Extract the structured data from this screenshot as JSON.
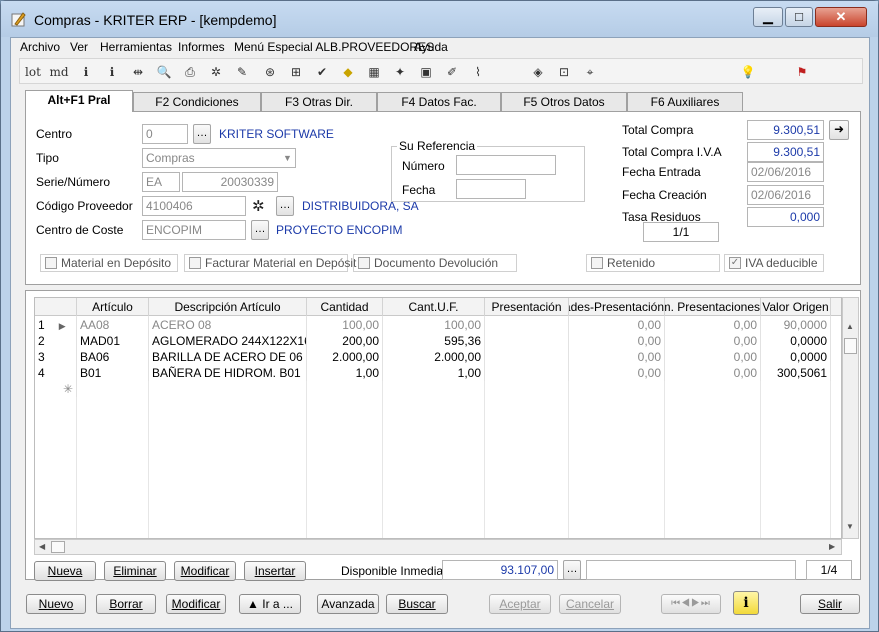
{
  "window": {
    "title": "Compras - KRITER ERP - [kempdemo]"
  },
  "menu": [
    "Archivo",
    "Ver",
    "Herramientas",
    "Informes",
    "Menú Especial ALB.PROVEEDORES",
    "Ayuda"
  ],
  "toolbar": {
    "lot_label": "lot",
    "md_label": "md"
  },
  "tabs": [
    "Alt+F1 Pral",
    "F2 Condiciones",
    "F3 Otras Dir.",
    "F4 Datos Fac.",
    "F5 Otros Datos",
    "F6 Auxiliares"
  ],
  "form": {
    "centro_label": "Centro",
    "centro_value": "0",
    "centro_name": "KRITER SOFTWARE",
    "tipo_label": "Tipo",
    "tipo_value": "Compras",
    "serie_label": "Serie/Número",
    "serie_value": "EA",
    "numero_value": "20030339",
    "proveedor_label": "Código Proveedor",
    "proveedor_value": "4100406",
    "proveedor_name": "DISTRIBUIDORA, SA",
    "coste_label": "Centro de Coste",
    "coste_value": "ENCOPIM",
    "coste_name": "PROYECTO ENCOPIM",
    "su_referencia_title": "Su Referencia",
    "su_numero_label": "Número",
    "su_fecha_label": "Fecha",
    "total_compra_label": "Total Compra",
    "total_compra_value": "9.300,51",
    "total_iva_label": "Total Compra I.V.A",
    "total_iva_value": "9.300,51",
    "fecha_entrada_label": "Fecha Entrada",
    "fecha_entrada_value": "02/06/2016",
    "fecha_creacion_label": "Fecha Creación",
    "fecha_creacion_value": "02/06/2016",
    "tasa_label": "Tasa Residuos",
    "tasa_value": "0,000",
    "pager_value": "1/1",
    "chk_material": "Material en Depósito",
    "chk_facturar": "Facturar Material en Depósit",
    "chk_devolucion": "Documento Devolución",
    "chk_retenido": "Retenido",
    "chk_iva": "IVA deducible"
  },
  "grid": {
    "headers": [
      "Artículo",
      "Descripción Artículo",
      "Cantidad",
      "Cant.U.F.",
      "Presentación",
      "Unidades-Presentación",
      "Num. Presentaciones",
      "Valor Origen"
    ],
    "rows": [
      {
        "n": "1",
        "art": "AA08",
        "desc": "ACERO 08",
        "cant": "100,00",
        "cuf": "100,00",
        "pres": "",
        "unip": "0,00",
        "nump": "0,00",
        "val": "90,0000"
      },
      {
        "n": "2",
        "art": "MAD01",
        "desc": "AGLOMERADO 244X122X16",
        "cant": "200,00",
        "cuf": "595,36",
        "pres": "",
        "unip": "0,00",
        "nump": "0,00",
        "val": "0,0000"
      },
      {
        "n": "3",
        "art": "BA06",
        "desc": "BARILLA DE ACERO DE 06",
        "cant": "2.000,00",
        "cuf": "2.000,00",
        "pres": "",
        "unip": "0,00",
        "nump": "0,00",
        "val": "0,0000"
      },
      {
        "n": "4",
        "art": "B01",
        "desc": "BAÑERA DE HIDROM. B01",
        "cant": "1,00",
        "cuf": "1,00",
        "pres": "",
        "unip": "0,00",
        "nump": "0,00",
        "val": "300,5061"
      }
    ]
  },
  "grid_buttons": {
    "nueva": "Nueva",
    "eliminar": "Eliminar",
    "modificar": "Modificar",
    "insertar": "Insertar"
  },
  "disponible": {
    "label": "Disponible Inmediato",
    "value": "93.107,00",
    "pager": "1/4"
  },
  "bottom_buttons": {
    "nuevo": "Nuevo",
    "borrar": "Borrar",
    "modificar": "Modificar",
    "ira": "▲ Ir a ...",
    "avanzada": "Avanzada",
    "buscar": "Buscar",
    "aceptar": "Aceptar",
    "cancelar": "Cancelar",
    "salir": "Salir"
  }
}
